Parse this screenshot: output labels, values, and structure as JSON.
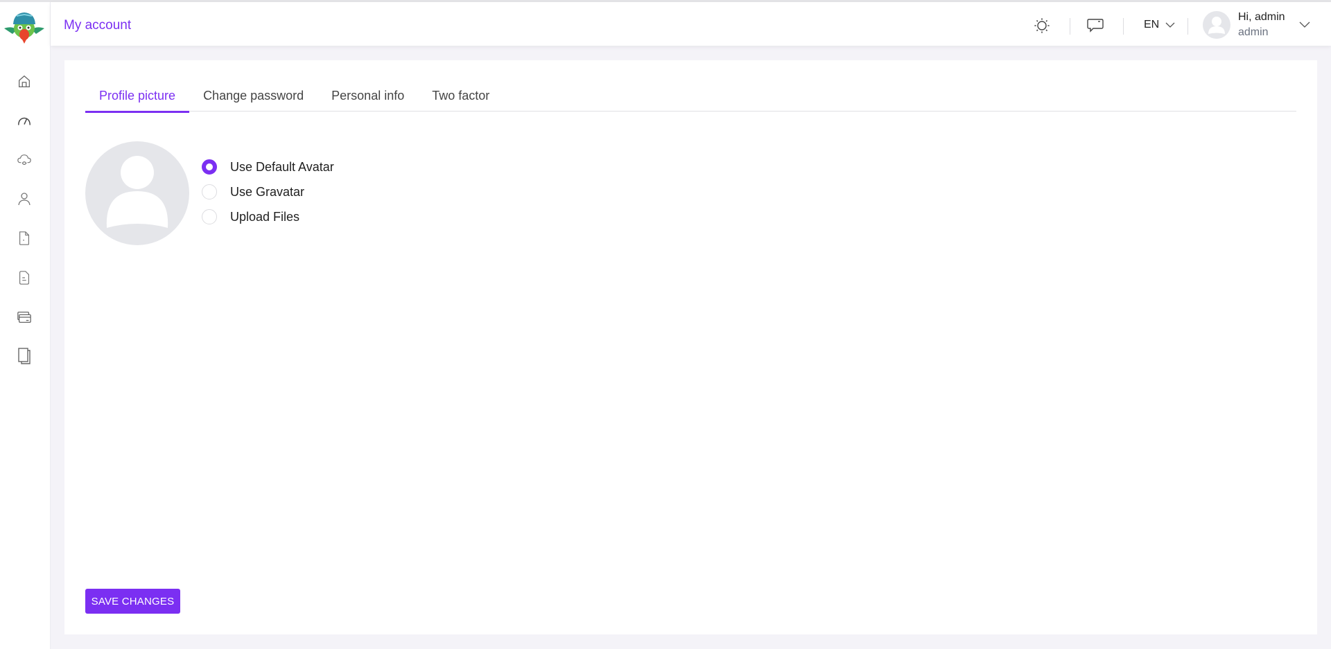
{
  "header": {
    "title": "My account",
    "theme_icon": "sun-icon",
    "chat_icon": "message-icon",
    "language": "EN",
    "user": {
      "greeting": "Hi, admin",
      "role": "admin"
    }
  },
  "sidebar": {
    "items": [
      {
        "name": "home",
        "icon": "home-icon"
      },
      {
        "name": "dashboard",
        "icon": "speedometer-icon"
      },
      {
        "name": "cloud",
        "icon": "cloud-icon"
      },
      {
        "name": "users",
        "icon": "users-icon"
      },
      {
        "name": "document",
        "icon": "file-icon"
      },
      {
        "name": "report",
        "icon": "file-text-icon"
      },
      {
        "name": "billing",
        "icon": "credit-card-icon"
      },
      {
        "name": "pages",
        "icon": "copy-icon"
      }
    ]
  },
  "main": {
    "tabs": [
      {
        "label": "Profile picture",
        "active": true
      },
      {
        "label": "Change password",
        "active": false
      },
      {
        "label": "Personal info",
        "active": false
      },
      {
        "label": "Two factor",
        "active": false
      }
    ],
    "avatar_options": [
      {
        "label": "Use Default Avatar",
        "checked": true
      },
      {
        "label": "Use Gravatar",
        "checked": false
      },
      {
        "label": "Upload Files",
        "checked": false
      }
    ],
    "save_label": "SAVE CHANGES"
  },
  "colors": {
    "accent": "#7b2ff2",
    "background": "#f4f3f8",
    "avatar_bg": "#e5e6ea"
  }
}
